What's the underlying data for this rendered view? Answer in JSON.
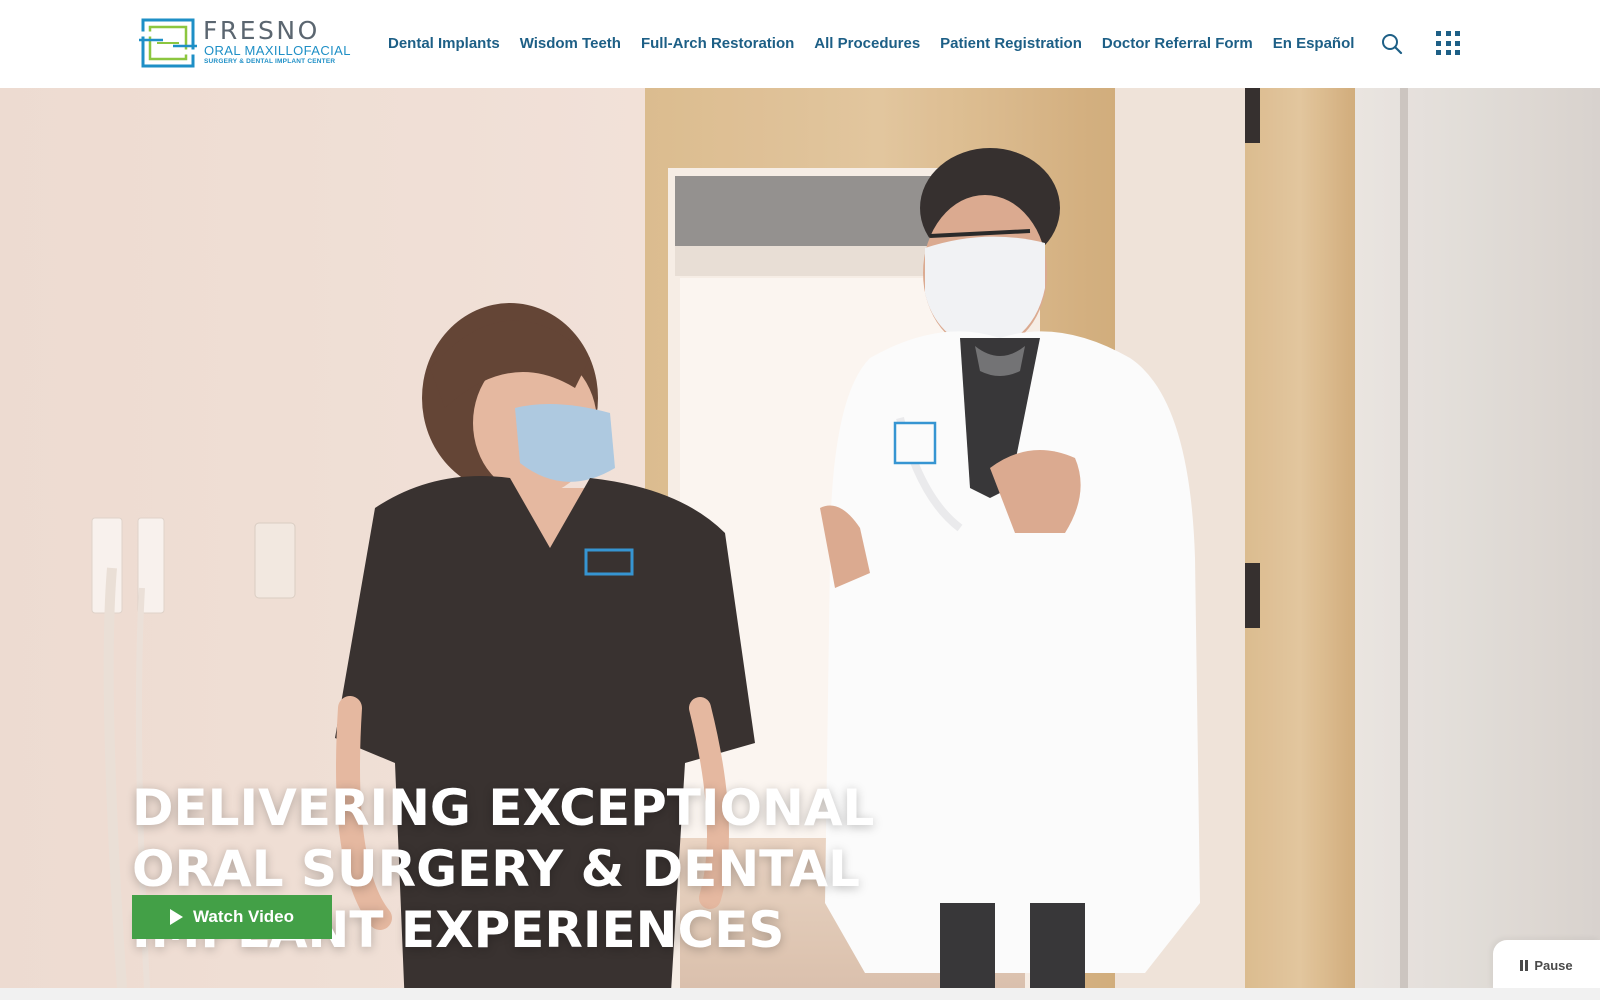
{
  "header": {
    "logo": {
      "wordmark": "FRESNO",
      "line1": "ORAL MAXILLOFACIAL",
      "line2": "SURGERY & DENTAL IMPLANT CENTER"
    },
    "nav": [
      {
        "label": "Dental Implants"
      },
      {
        "label": "Wisdom Teeth"
      },
      {
        "label": "Full-Arch Restoration"
      },
      {
        "label": "All Procedures"
      },
      {
        "label": "Patient Registration"
      },
      {
        "label": "Doctor Referral Form"
      },
      {
        "label": "En Español"
      }
    ],
    "icons": {
      "search": "search-icon",
      "menu": "grid-menu-icon"
    }
  },
  "hero": {
    "title": "DELIVERING EXCEPTIONAL ORAL SURGERY & DENTAL IMPLANT EXPERIENCES",
    "watch_button": "Watch Video",
    "pause_button": "Pause"
  },
  "colors": {
    "nav_text": "#1d5f86",
    "logo_blue": "#1e8fc6",
    "logo_green": "#8cc63f",
    "cta_green": "#43a047",
    "hero_title": "#ffffff"
  }
}
